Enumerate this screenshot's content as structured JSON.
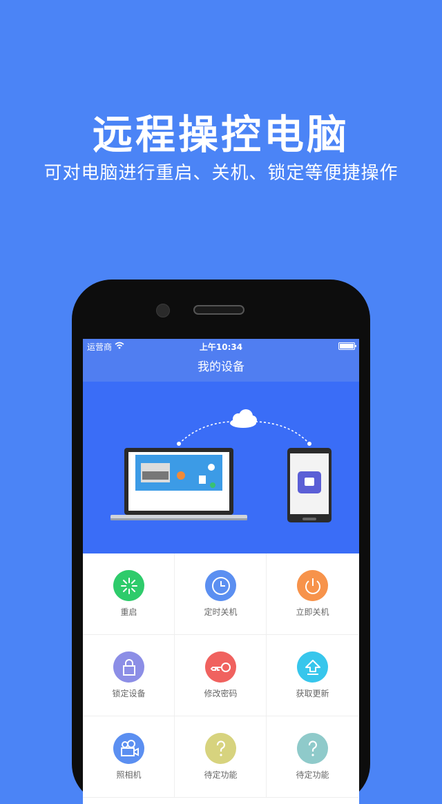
{
  "promo": {
    "title": "远程操控电脑",
    "subtitle": "可对电脑进行重启、关机、锁定等便捷操作"
  },
  "status_bar": {
    "carrier": "运营商",
    "time": "上午10:34"
  },
  "nav": {
    "title": "我的设备"
  },
  "actions": [
    {
      "label": "重启",
      "icon": "restart-icon",
      "color": "#2ecb6b"
    },
    {
      "label": "定时关机",
      "icon": "clock-icon",
      "color": "#5b8ff1"
    },
    {
      "label": "立即关机",
      "icon": "power-icon",
      "color": "#f7934b"
    },
    {
      "label": "锁定设备",
      "icon": "lock-icon",
      "color": "#8c8ee6"
    },
    {
      "label": "修改密码",
      "icon": "key-icon",
      "color": "#f0625f"
    },
    {
      "label": "获取更新",
      "icon": "upload-icon",
      "color": "#37c6ec"
    },
    {
      "label": "照相机",
      "icon": "camera-icon",
      "color": "#5b8ff1"
    },
    {
      "label": "待定功能",
      "icon": "question-icon",
      "color": "#d7d37e"
    },
    {
      "label": "待定功能",
      "icon": "question-icon",
      "color": "#8fcaca"
    }
  ],
  "colors": {
    "page_bg": "#4b84f6",
    "nav_bg": "#507ef1",
    "hero_bg": "#3a6df7"
  }
}
